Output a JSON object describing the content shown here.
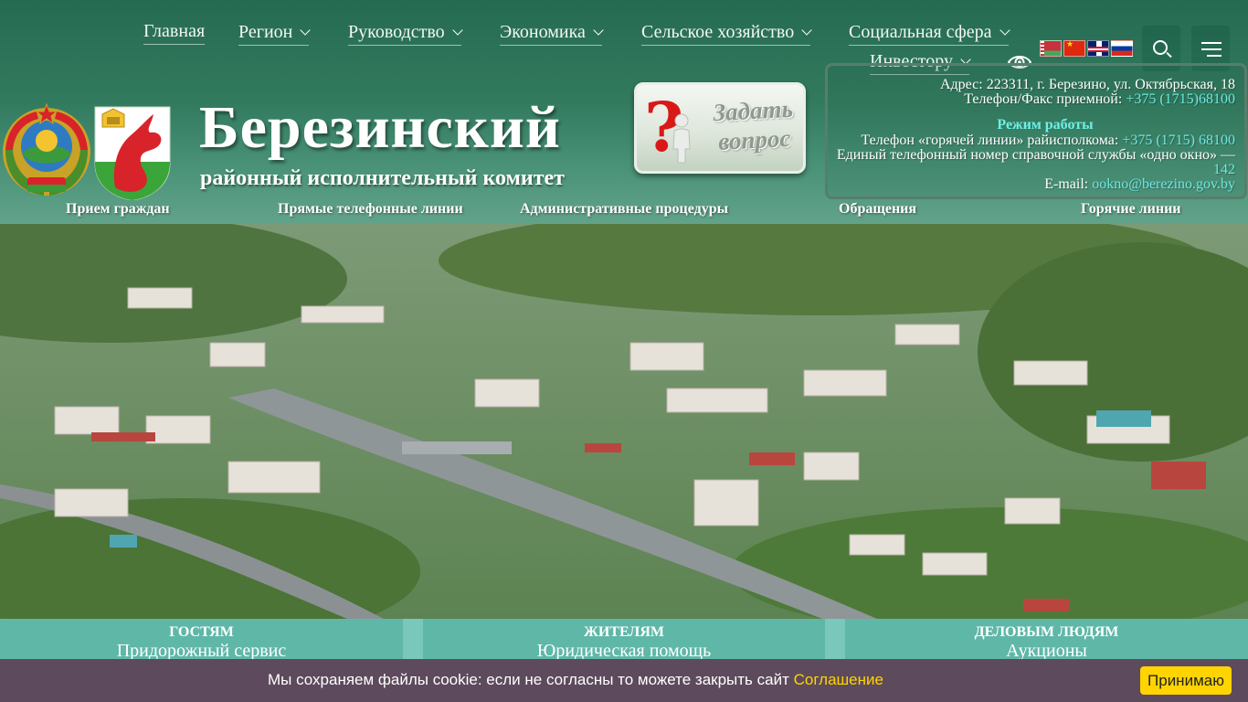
{
  "nav": {
    "items": [
      {
        "label": "Главная",
        "dropdown": false
      },
      {
        "label": "Регион",
        "dropdown": true
      },
      {
        "label": "Руководство",
        "dropdown": true
      },
      {
        "label": "Экономика",
        "dropdown": true
      },
      {
        "label": "Сельское хозяйство",
        "dropdown": true
      },
      {
        "label": "Социальная сфера",
        "dropdown": true
      },
      {
        "label": "Инвестору",
        "dropdown": true
      }
    ]
  },
  "languages": [
    "be-flag-icon",
    "cn-flag-icon",
    "gb-flag-icon",
    "ru-flag-icon"
  ],
  "header": {
    "title": "Березинский",
    "subtitle": "районный исполнительный комитет",
    "ask_button": "Задать вопрос"
  },
  "contact": {
    "address": "Адрес: 223311, г. Березино, ул. Октябрьская, 18",
    "reception_label": "Телефон/Факс приемной:",
    "reception_phone": "+375 (1715)68100",
    "work_mode": "Режим работы",
    "hotline_label": "Телефон «горячей линии» райисполкома:",
    "hotline_phone": "+375 (1715) 68100",
    "one_window_label": "Единый телефонный номер справочной службы «одно окно» —",
    "one_window_number": "142",
    "email_label": "E-mail:",
    "email": "ookno@berezino.gov.by"
  },
  "quick_links": [
    "Прием граждан",
    "Прямые телефонные линии",
    "Административные процедуры",
    "Обращения",
    "Горячие линии"
  ],
  "cards": [
    {
      "title": "ГОСТЯМ",
      "link": "Придорожный сервис"
    },
    {
      "title": "ЖИТЕЛЯМ",
      "link": "Юридическая помощь"
    },
    {
      "title": "ДЕЛОВЫМ ЛЮДЯМ",
      "link": "Аукционы"
    }
  ],
  "cookie": {
    "text": "Мы сохраняем файлы cookie: если не согласны то можете закрыть сайт",
    "link": "Соглашение",
    "button": "Принимаю"
  },
  "colors": {
    "header_green": "#327a5e",
    "accent_link": "#6de8e0",
    "card_teal": "#5fb7a8",
    "cookie_bg": "#5d4a5c",
    "cookie_button": "#ffd400"
  }
}
